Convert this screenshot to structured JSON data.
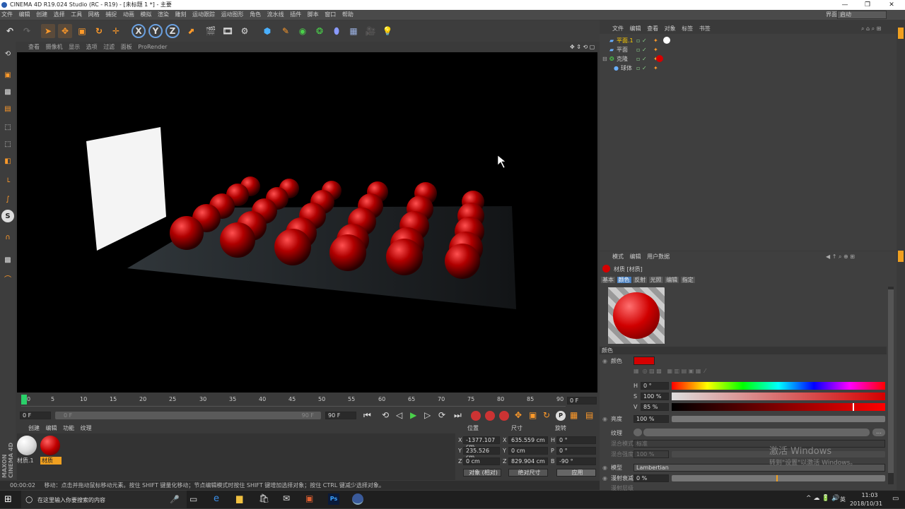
{
  "titlebar": {
    "title": "CINEMA 4D R19.024 Studio (RC - R19) - [未标题 1 *] - 主要",
    "min": "—",
    "max": "❐",
    "close": "✕"
  },
  "menubar": {
    "items": [
      "文件",
      "编辑",
      "创建",
      "选择",
      "工具",
      "网格",
      "捕捉",
      "动画",
      "模拟",
      "渲染",
      "雕刻",
      "运动跟踪",
      "运动图形",
      "角色",
      "流水线",
      "插件",
      "脚本",
      "窗口",
      "帮助"
    ],
    "layout_label": "界面:",
    "layout_value": "启动"
  },
  "toolbar": {
    "x": "X",
    "y": "Y",
    "z": "Z"
  },
  "viewport": {
    "menu": [
      "查看",
      "摄像机",
      "显示",
      "选项",
      "过滤",
      "面板",
      "ProRender"
    ]
  },
  "timeline": {
    "ticks": [
      "0",
      "5",
      "10",
      "15",
      "20",
      "25",
      "30",
      "35",
      "40",
      "45",
      "50",
      "55",
      "60",
      "65",
      "70",
      "75",
      "80",
      "85",
      "90"
    ],
    "end_field": "0 F"
  },
  "playbar": {
    "start": "0 F",
    "slider_start": "0 F",
    "slider_end": "90 F",
    "end": "90 F"
  },
  "materials": {
    "menu": [
      "创建",
      "编辑",
      "功能",
      "纹理"
    ],
    "items": [
      {
        "name": "材质.1"
      },
      {
        "name": "材质"
      }
    ]
  },
  "coords": {
    "headers": [
      "位置",
      "尺寸",
      "旋转"
    ],
    "rows": [
      {
        "axis": "X",
        "pos": "-1377.107 cm",
        "saxis": "X",
        "size": "635.559 cm",
        "raxis": "H",
        "rot": "0 °"
      },
      {
        "axis": "Y",
        "pos": "235.526 cm",
        "saxis": "Y",
        "size": "0 cm",
        "raxis": "P",
        "rot": "0 °"
      },
      {
        "axis": "Z",
        "pos": "0 cm",
        "saxis": "Z",
        "size": "829.904 cm",
        "raxis": "B",
        "rot": "-90 °"
      }
    ],
    "mode": "对象 (相对)",
    "size_mode": "绝对尺寸",
    "apply": "应用"
  },
  "status": {
    "time": "00:00:02",
    "text": "移动：点击并拖动鼠标移动元素。按住 SHIFT 键量化移动；节点编辑模式时按住 SHIFT 键增加选择对象；按住 CTRL 键减少选择对象。"
  },
  "objmgr": {
    "menu": [
      "文件",
      "编辑",
      "查看",
      "对象",
      "标签",
      "书签"
    ],
    "objects": [
      {
        "name": "平面.1"
      },
      {
        "name": "平面"
      },
      {
        "name": "克隆"
      },
      {
        "name": "球体"
      }
    ]
  },
  "attr": {
    "menu": [
      "模式",
      "编辑",
      "用户数据"
    ],
    "title": "材质 [材质]",
    "tabs": [
      "基本",
      "颜色",
      "反射",
      "光照",
      "编辑",
      "指定"
    ],
    "section": "颜色",
    "color_label": "颜色",
    "h_label": "H",
    "h_value": "0 °",
    "s_label": "S",
    "s_value": "100 %",
    "v_label": "V",
    "v_value": "85 %",
    "brightness_label": "亮度",
    "brightness_value": "100 %",
    "texture_label": "纹理",
    "blend_mode_label": "混合模式",
    "blend_mode_value": "标准",
    "blend_strength_label": "混合强度",
    "blend_strength_value": "100 %",
    "model_label": "模型",
    "model_value": "Lambertian",
    "diffuse_label": "漫射衰减",
    "diffuse_value": "0 %",
    "diffuse_level_label": "漫射层级",
    "accent": "#d40000"
  },
  "watermark": {
    "line1": "激活 Windows",
    "line2": "转到\"设置\"以激活 Windows。"
  },
  "taskbar": {
    "search": "在这里输入你要搜索的内容",
    "lang": "英",
    "time": "11:03",
    "date": "2018/10/31"
  },
  "branding": {
    "logo": "MAXON CINEMA 4D"
  }
}
